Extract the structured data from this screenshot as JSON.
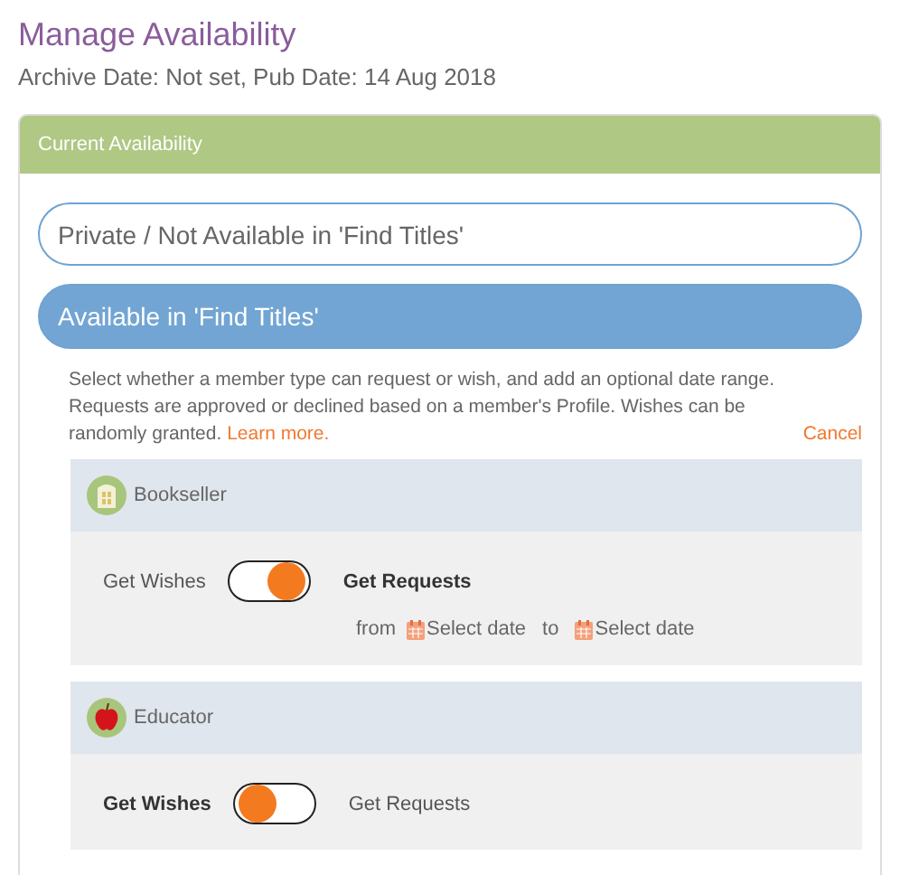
{
  "title": "Manage Availability",
  "subtitle": "Archive Date: Not set, Pub Date: 14 Aug 2018",
  "panel": {
    "header": "Current Availability",
    "options": [
      {
        "label": "Private / Not Available in 'Find Titles'",
        "selected": false
      },
      {
        "label": "Available in 'Find Titles'",
        "selected": true
      }
    ],
    "description": "Select whether a member type can request or wish, and add an optional date range. Requests are approved or declined based on a member's Profile. Wishes can be randomly granted.",
    "learn_more": "Learn more.",
    "cancel": "Cancel",
    "members": [
      {
        "name": "Bookseller",
        "kind": "bookseller",
        "wishes_label": "Get Wishes",
        "requests_label": "Get Requests",
        "requests": true,
        "dates": {
          "from": "from",
          "start": "Select date",
          "to": "to",
          "end": "Select date"
        }
      },
      {
        "name": "Educator",
        "kind": "educator",
        "wishes_label": "Get Wishes",
        "requests_label": "Get Requests",
        "requests": false
      }
    ]
  }
}
